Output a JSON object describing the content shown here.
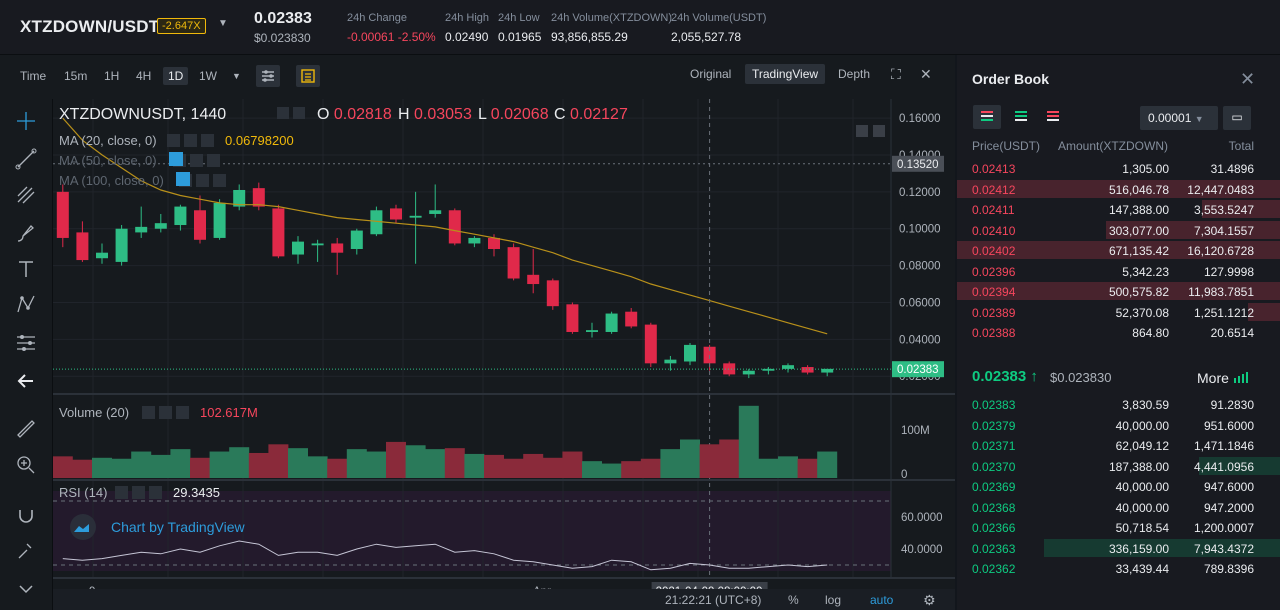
{
  "header": {
    "symbol": "XTZDOWN/USDT",
    "leverage": "-2.647X",
    "last_price": "0.02383",
    "last_price_usd": "$0.023830",
    "stats": [
      {
        "label": "24h Change",
        "value": "-0.00061 -2.50%",
        "color": "red"
      },
      {
        "label": "24h High",
        "value": "0.02490",
        "color": ""
      },
      {
        "label": "24h Low",
        "value": "0.01965",
        "color": ""
      },
      {
        "label": "24h Volume(XTZDOWN)",
        "value": "93,856,855.29",
        "color": ""
      },
      {
        "label": "24h Volume(USDT)",
        "value": "2,055,527.78",
        "color": ""
      }
    ]
  },
  "toolbar": {
    "timeframes": [
      "Time",
      "15m",
      "1H",
      "4H",
      "1D",
      "1W"
    ],
    "selected": "1D",
    "views": [
      "Original",
      "TradingView",
      "Depth"
    ],
    "selected_view": "TradingView"
  },
  "chart_data": {
    "type": "candlestick",
    "title": "XTZDOWNUSDT, 1440",
    "ohlc_legend": {
      "O": "0.02818",
      "H": "0.03053",
      "L": "0.02068",
      "C": "0.02127"
    },
    "indicators": [
      {
        "name": "MA (20, close, 0)",
        "value": "0.06798200"
      },
      {
        "name": "MA (50, close, 0)",
        "value": ""
      },
      {
        "name": "MA (100, close, 0)",
        "value": ""
      }
    ],
    "y_ticks": [
      "0.16000",
      "0.14000",
      "0.12000",
      "0.10000",
      "0.08000",
      "0.06000",
      "0.04000",
      "0.02000"
    ],
    "ylim": [
      0.012,
      0.166
    ],
    "marker_price": "0.13520",
    "current_price": "0.02383",
    "x_labels": [
      "9",
      "Apr",
      "2021-04-09 08:00:00"
    ],
    "candles": [
      {
        "o": 0.12,
        "h": 0.124,
        "l": 0.09,
        "c": 0.095
      },
      {
        "o": 0.098,
        "h": 0.104,
        "l": 0.082,
        "c": 0.083
      },
      {
        "o": 0.084,
        "h": 0.092,
        "l": 0.081,
        "c": 0.087
      },
      {
        "o": 0.082,
        "h": 0.102,
        "l": 0.08,
        "c": 0.1
      },
      {
        "o": 0.098,
        "h": 0.112,
        "l": 0.095,
        "c": 0.101
      },
      {
        "o": 0.1,
        "h": 0.108,
        "l": 0.098,
        "c": 0.103
      },
      {
        "o": 0.102,
        "h": 0.113,
        "l": 0.099,
        "c": 0.112
      },
      {
        "o": 0.11,
        "h": 0.118,
        "l": 0.092,
        "c": 0.094
      },
      {
        "o": 0.095,
        "h": 0.116,
        "l": 0.094,
        "c": 0.114
      },
      {
        "o": 0.112,
        "h": 0.124,
        "l": 0.11,
        "c": 0.121
      },
      {
        "o": 0.122,
        "h": 0.125,
        "l": 0.11,
        "c": 0.112
      },
      {
        "o": 0.111,
        "h": 0.113,
        "l": 0.084,
        "c": 0.085
      },
      {
        "o": 0.086,
        "h": 0.096,
        "l": 0.081,
        "c": 0.093
      },
      {
        "o": 0.091,
        "h": 0.094,
        "l": 0.082,
        "c": 0.092
      },
      {
        "o": 0.092,
        "h": 0.095,
        "l": 0.075,
        "c": 0.087
      },
      {
        "o": 0.089,
        "h": 0.1,
        "l": 0.086,
        "c": 0.099
      },
      {
        "o": 0.097,
        "h": 0.112,
        "l": 0.096,
        "c": 0.11
      },
      {
        "o": 0.111,
        "h": 0.113,
        "l": 0.103,
        "c": 0.105
      },
      {
        "o": 0.106,
        "h": 0.12,
        "l": 0.081,
        "c": 0.107
      },
      {
        "o": 0.108,
        "h": 0.124,
        "l": 0.106,
        "c": 0.11
      },
      {
        "o": 0.11,
        "h": 0.111,
        "l": 0.091,
        "c": 0.092
      },
      {
        "o": 0.092,
        "h": 0.096,
        "l": 0.09,
        "c": 0.095
      },
      {
        "o": 0.095,
        "h": 0.097,
        "l": 0.085,
        "c": 0.089
      },
      {
        "o": 0.09,
        "h": 0.092,
        "l": 0.072,
        "c": 0.073
      },
      {
        "o": 0.075,
        "h": 0.089,
        "l": 0.065,
        "c": 0.07
      },
      {
        "o": 0.072,
        "h": 0.073,
        "l": 0.056,
        "c": 0.058
      },
      {
        "o": 0.059,
        "h": 0.06,
        "l": 0.043,
        "c": 0.044
      },
      {
        "o": 0.044,
        "h": 0.049,
        "l": 0.041,
        "c": 0.045
      },
      {
        "o": 0.044,
        "h": 0.055,
        "l": 0.043,
        "c": 0.054
      },
      {
        "o": 0.055,
        "h": 0.057,
        "l": 0.046,
        "c": 0.047
      },
      {
        "o": 0.048,
        "h": 0.049,
        "l": 0.025,
        "c": 0.027
      },
      {
        "o": 0.027,
        "h": 0.031,
        "l": 0.023,
        "c": 0.029
      },
      {
        "o": 0.028,
        "h": 0.038,
        "l": 0.026,
        "c": 0.037
      },
      {
        "o": 0.036,
        "h": 0.037,
        "l": 0.023,
        "c": 0.027
      },
      {
        "o": 0.027,
        "h": 0.028,
        "l": 0.02,
        "c": 0.021
      },
      {
        "o": 0.021,
        "h": 0.024,
        "l": 0.019,
        "c": 0.023
      },
      {
        "o": 0.023,
        "h": 0.025,
        "l": 0.021,
        "c": 0.024
      },
      {
        "o": 0.024,
        "h": 0.027,
        "l": 0.022,
        "c": 0.026
      },
      {
        "o": 0.025,
        "h": 0.026,
        "l": 0.021,
        "c": 0.022
      },
      {
        "o": 0.022,
        "h": 0.024,
        "l": 0.02,
        "c": 0.024
      }
    ],
    "ma20": [
      0.16,
      0.148,
      0.14,
      0.133,
      0.126,
      0.121,
      0.118,
      0.116,
      0.114,
      0.113,
      0.113,
      0.112,
      0.11,
      0.108,
      0.106,
      0.105,
      0.104,
      0.103,
      0.102,
      0.101,
      0.099,
      0.097,
      0.095,
      0.093,
      0.09,
      0.087,
      0.083,
      0.08,
      0.077,
      0.074,
      0.07,
      0.067,
      0.064,
      0.061,
      0.058,
      0.055,
      0.052,
      0.049,
      0.046,
      0.043
    ],
    "volume": {
      "label": "Volume (20)",
      "value": "102.617M",
      "ticks": [
        "100M",
        "0"
      ],
      "ylim": [
        0,
        160
      ],
      "values": [
        45,
        38,
        42,
        40,
        55,
        48,
        60,
        42,
        55,
        64,
        52,
        70,
        62,
        45,
        40,
        60,
        55,
        75,
        68,
        60,
        62,
        50,
        48,
        40,
        50,
        42,
        55,
        35,
        30,
        35,
        40,
        60,
        80,
        70,
        80,
        150,
        40,
        45,
        40,
        55
      ]
    },
    "rsi": {
      "label": "RSI (14)",
      "value": "29.3435",
      "ticks": [
        "60.0000",
        "40.0000"
      ],
      "ylim": [
        25,
        80
      ],
      "values": [
        34,
        33,
        34,
        36,
        38,
        37,
        40,
        38,
        42,
        45,
        43,
        36,
        38,
        38,
        36,
        40,
        43,
        41,
        42,
        43,
        38,
        39,
        37,
        33,
        32,
        30,
        28,
        29,
        33,
        32,
        27,
        28,
        31,
        30,
        28,
        28,
        29,
        30,
        29,
        30
      ]
    },
    "watermark": "Chart by TradingView"
  },
  "footer": {
    "time": "21:22:21 (UTC+8)",
    "buttons": [
      "%",
      "log",
      "auto"
    ]
  },
  "orderbook": {
    "title": "Order Book",
    "precision": "0.00001",
    "headers": [
      "Price(USDT)",
      "Amount(XTZDOWN)",
      "Total"
    ],
    "asks": [
      {
        "p": "0.02413",
        "a": "1,305.00",
        "t": "31.4896",
        "d": 0.0
      },
      {
        "p": "0.02412",
        "a": "516,046.78",
        "t": "12,447.0483",
        "d": 1.0
      },
      {
        "p": "0.02411",
        "a": "147,388.00",
        "t": "3,553.5247",
        "d": 0.24
      },
      {
        "p": "0.02410",
        "a": "303,077.00",
        "t": "7,304.1557",
        "d": 0.54
      },
      {
        "p": "0.02402",
        "a": "671,135.42",
        "t": "16,120.6728",
        "d": 1.0
      },
      {
        "p": "0.02396",
        "a": "5,342.23",
        "t": "127.9998",
        "d": 0.0
      },
      {
        "p": "0.02394",
        "a": "500,575.82",
        "t": "11,983.7851",
        "d": 1.0
      },
      {
        "p": "0.02389",
        "a": "52,370.08",
        "t": "1,251.1212",
        "d": 0.1
      },
      {
        "p": "0.02388",
        "a": "864.80",
        "t": "20.6514",
        "d": 0.0
      }
    ],
    "mid": {
      "price": "0.02383",
      "usd": "$0.023830",
      "more": "More"
    },
    "bids": [
      {
        "p": "0.02383",
        "a": "3,830.59",
        "t": "91.2830",
        "d": 0.0
      },
      {
        "p": "0.02379",
        "a": "40,000.00",
        "t": "951.6000",
        "d": 0.0
      },
      {
        "p": "0.02371",
        "a": "62,049.12",
        "t": "1,471.1846",
        "d": 0.0
      },
      {
        "p": "0.02370",
        "a": "187,388.00",
        "t": "4,441.0956",
        "d": 0.25
      },
      {
        "p": "0.02369",
        "a": "40,000.00",
        "t": "947.6000",
        "d": 0.0
      },
      {
        "p": "0.02368",
        "a": "40,000.00",
        "t": "947.2000",
        "d": 0.0
      },
      {
        "p": "0.02366",
        "a": "50,718.54",
        "t": "1,200.0007",
        "d": 0.0
      },
      {
        "p": "0.02363",
        "a": "336,159.00",
        "t": "7,943.4372",
        "d": 0.73
      },
      {
        "p": "0.02362",
        "a": "33,439.44",
        "t": "789.8396",
        "d": 0.0
      }
    ]
  },
  "colors": {
    "up": "#0ecb81",
    "down": "#f6465d",
    "candle_up": "#2ebd85",
    "candle_down": "#e0294a",
    "ma": "#b8901a"
  }
}
